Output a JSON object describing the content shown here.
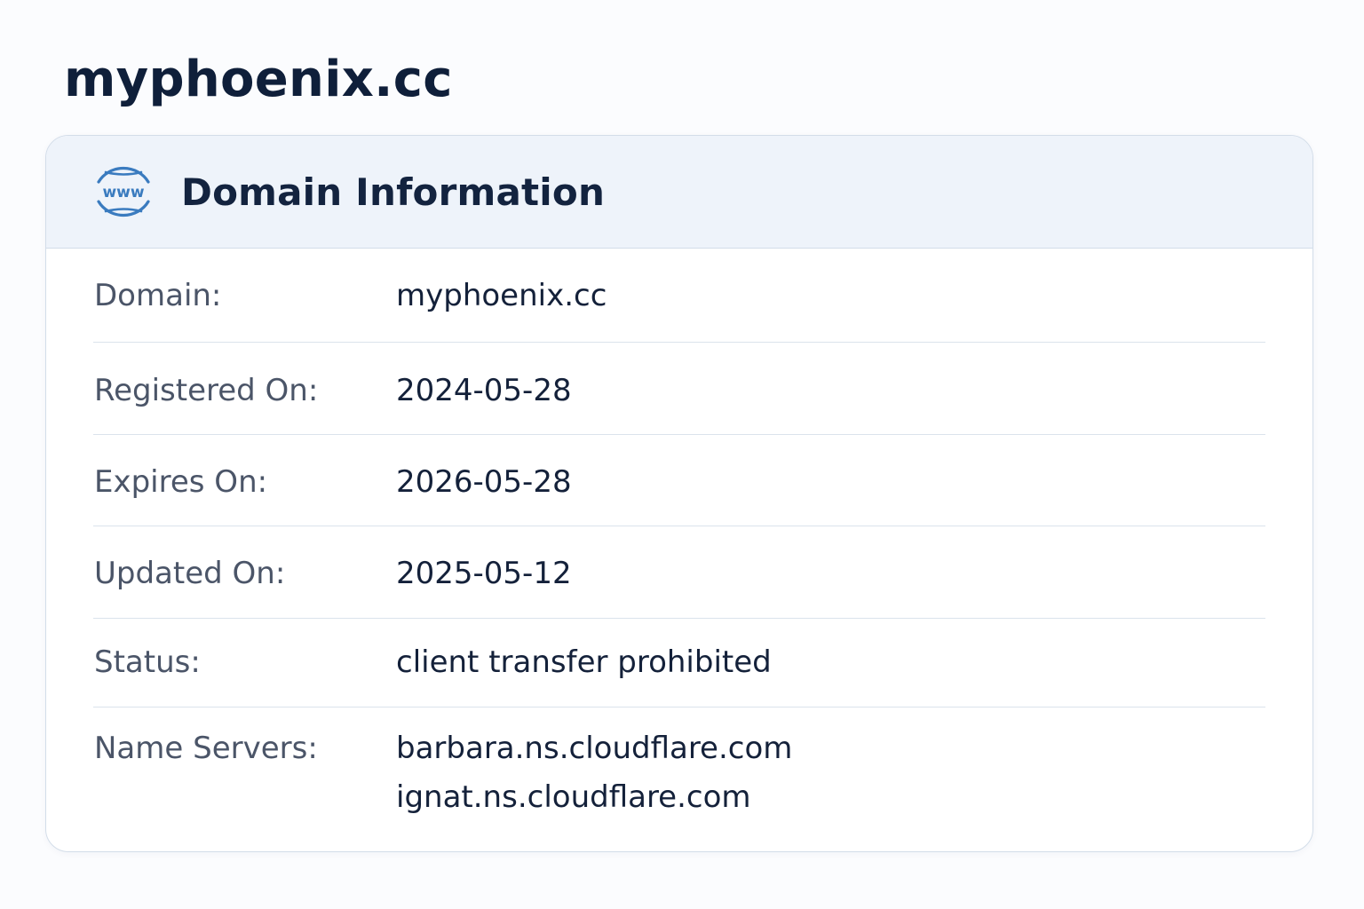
{
  "page": {
    "title": "myphoenix.cc"
  },
  "card": {
    "header": {
      "icon": "www-globe-icon",
      "icon_text": "www",
      "title": "Domain Information"
    },
    "rows": [
      {
        "label": "Domain:",
        "value": "myphoenix.cc"
      },
      {
        "label": "Registered On:",
        "value": "2024-05-28"
      },
      {
        "label": "Expires On:",
        "value": "2026-05-28"
      },
      {
        "label": "Updated On:",
        "value": "2025-05-12"
      },
      {
        "label": "Status:",
        "value": "client transfer prohibited"
      },
      {
        "label": "Name Servers:",
        "values": [
          "barbara.ns.cloudflare.com",
          "ignat.ns.cloudflare.com"
        ]
      }
    ]
  },
  "colors": {
    "accent": "#3a7bbf",
    "title_text": "#0f1f3a",
    "label_text": "#4b5568",
    "header_bg": "#eef3fa",
    "border": "#d3dde9"
  }
}
